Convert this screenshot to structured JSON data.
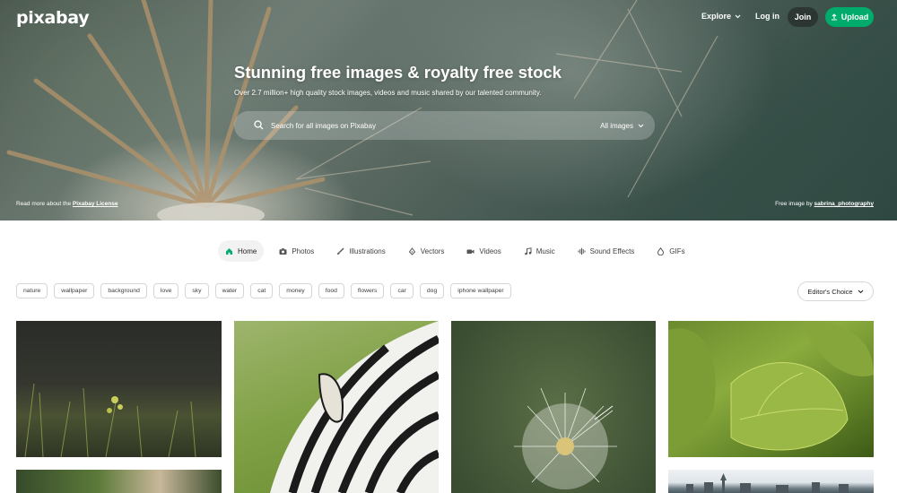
{
  "brand": {
    "logo": "pixabay",
    "accent": "#00ab6b"
  },
  "nav": {
    "explore": "Explore",
    "login": "Log in",
    "join": "Join",
    "upload": "Upload"
  },
  "hero": {
    "title": "Stunning free images & royalty free stock",
    "subtitle": "Over 2.7 million+ high quality stock images, videos and music shared by our talented community.",
    "search_placeholder": "Search for all images on Pixabay",
    "search_type": "All images",
    "license_prefix": "Read more about the",
    "license_link": "Pixabay License",
    "credit_prefix": "Free image by",
    "credit_author": "sabrina_photography"
  },
  "tabs": [
    {
      "label": "Home",
      "icon": "home-icon",
      "active": true
    },
    {
      "label": "Photos",
      "icon": "camera-icon"
    },
    {
      "label": "Illustrations",
      "icon": "brush-icon"
    },
    {
      "label": "Vectors",
      "icon": "pen-nib-icon"
    },
    {
      "label": "Videos",
      "icon": "video-icon"
    },
    {
      "label": "Music",
      "icon": "music-note-icon"
    },
    {
      "label": "Sound Effects",
      "icon": "waveform-icon"
    },
    {
      "label": "GIFs",
      "icon": "gif-icon"
    }
  ],
  "tags": [
    "nature",
    "wallpaper",
    "background",
    "love",
    "sky",
    "water",
    "cat",
    "money",
    "food",
    "flowers",
    "car",
    "dog",
    "iphone wallpaper"
  ],
  "sort": {
    "label": "Editor's Choice"
  },
  "photos": [
    {
      "subject": "grass field"
    },
    {
      "subject": "zebra"
    },
    {
      "subject": "dandelion"
    },
    {
      "subject": "hosta leaves"
    },
    {
      "subject": "tropical plants"
    },
    {
      "subject": "town skyline"
    }
  ]
}
